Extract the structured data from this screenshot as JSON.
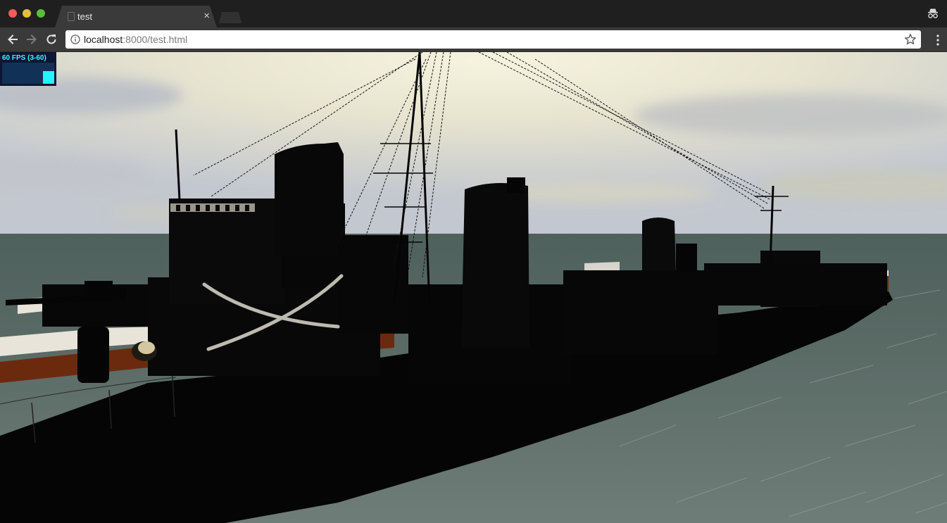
{
  "window": {
    "tab_title": "test",
    "tab_close_glyph": "×"
  },
  "toolbar": {
    "url_host": "localhost",
    "url_rest": ":8000/test.html"
  },
  "icons": {
    "back": "arrow-left-icon",
    "forward": "arrow-right-icon",
    "reload": "reload-icon",
    "info": "info-icon",
    "bookmark": "star-icon",
    "menu": "kebab-menu-icon",
    "incognito": "incognito-icon"
  },
  "stats": {
    "label": "60 FPS (3-60)",
    "current_fps": 60,
    "min_fps": 3,
    "max_fps": 60
  },
  "colors": {
    "sea": "#5e6d67",
    "sky_top": "#c9ccd2",
    "sky_glow": "#f4f0da",
    "hull": "#050505",
    "deck": "#6b2a0e",
    "fps_text": "#3ff3ff"
  }
}
